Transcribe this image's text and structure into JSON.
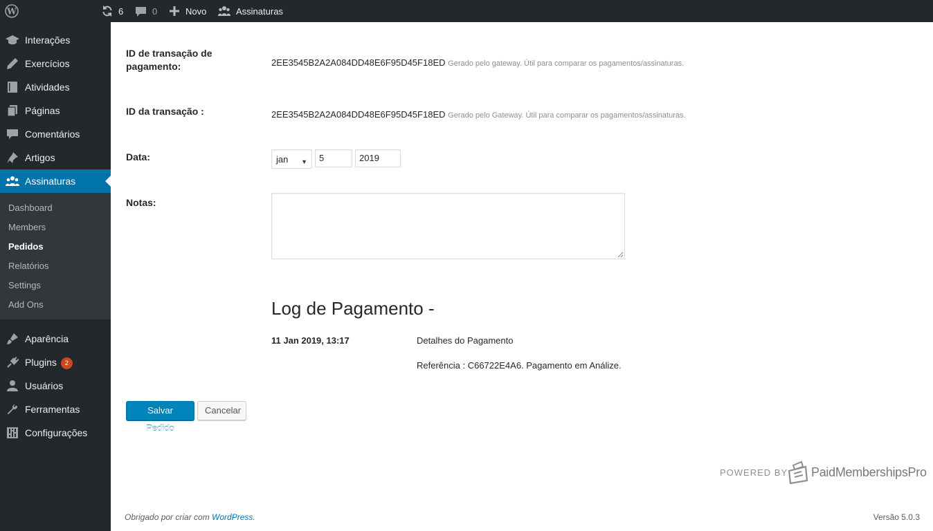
{
  "adminbar": {
    "updates_count": "6",
    "comments_count": "0",
    "new_label": "Novo",
    "site_menu_label": "Assinaturas"
  },
  "sidebar": {
    "items": [
      {
        "label": "Interações",
        "icon": "graduation-cap-icon"
      },
      {
        "label": "Exercícios",
        "icon": "pencil-icon"
      },
      {
        "label": "Atividades",
        "icon": "book-icon"
      },
      {
        "label": "Páginas",
        "icon": "pages-icon"
      },
      {
        "label": "Comentários",
        "icon": "comment-icon"
      },
      {
        "label": "Artigos",
        "icon": "pin-icon"
      },
      {
        "label": "Assinaturas",
        "icon": "groups-icon"
      }
    ],
    "submenu": [
      "Dashboard",
      "Members",
      "Pedidos",
      "Relatórios",
      "Settings",
      "Add Ons"
    ],
    "lower_items": [
      {
        "label": "Aparência",
        "icon": "brush-icon"
      },
      {
        "label": "Plugins",
        "icon": "plugin-icon",
        "badge": "2"
      },
      {
        "label": "Usuários",
        "icon": "user-icon"
      },
      {
        "label": "Ferramentas",
        "icon": "wrench-icon"
      },
      {
        "label": "Configurações",
        "icon": "settings-icon"
      }
    ]
  },
  "form": {
    "payment_txn_label": "ID de transação de pagamento:",
    "payment_txn_value": "2EE3545B2A2A084DD48E6F95D45F18ED",
    "payment_txn_desc": "Gerado pelo gateway. Útil para comparar os pagamentos/assinaturas.",
    "txn_label": "ID da transação :",
    "txn_value": "2EE3545B2A2A084DD48E6F95D45F18ED",
    "txn_desc": "Gerado pelo Gateway. Útil para comparar os pagamentos/assinaturas.",
    "date_label": "Data:",
    "date_month": "jan",
    "date_day": "5",
    "date_year": "2019",
    "notes_label": "Notas:"
  },
  "log": {
    "title": "Log de Pagamento -",
    "date": "11 Jan 2019, 13:17",
    "detail_title": "Detalhes do Pagamento",
    "detail_ref": "Referência : C66722E4A6. Pagamento em Análize."
  },
  "buttons": {
    "save": "Salvar Pedido",
    "cancel": "Cancelar"
  },
  "branding": {
    "powered_by": "POWERED BY",
    "name": "PaidMembershipsPro"
  },
  "footer": {
    "thanks_prefix": "Obrigado por criar com ",
    "thanks_link": "WordPress",
    "thanks_suffix": ".",
    "version": "Versão 5.0.3"
  },
  "colors": {
    "accent": "#0073aa",
    "admin_dark": "#23282d",
    "badge": "#ca4a1f"
  }
}
